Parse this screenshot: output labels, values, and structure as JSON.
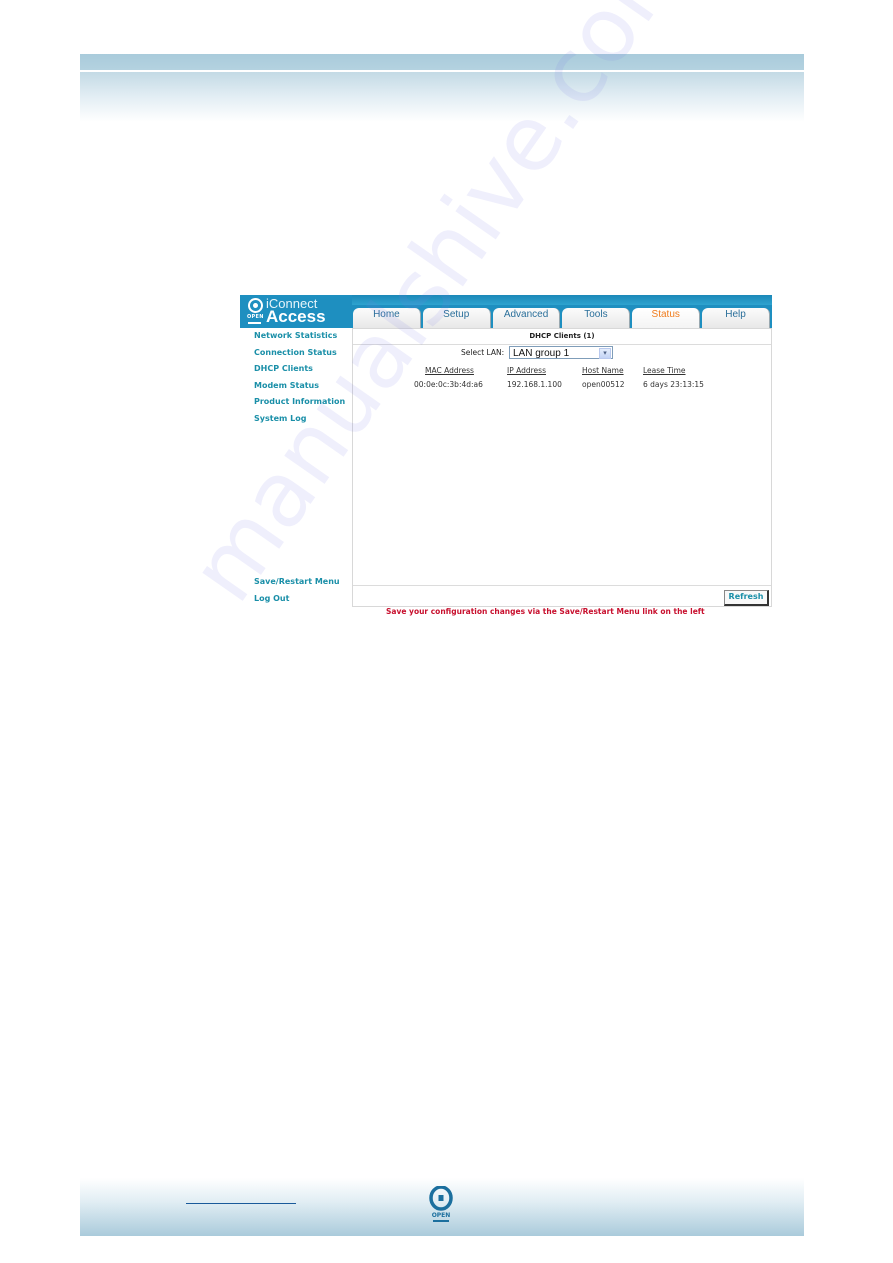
{
  "brand": {
    "line1": "iConnect",
    "line2": "Access",
    "logo_mini": "OPEN"
  },
  "tabs": [
    {
      "label": "Home",
      "active": false
    },
    {
      "label": "Setup",
      "active": false
    },
    {
      "label": "Advanced",
      "active": false
    },
    {
      "label": "Tools",
      "active": false
    },
    {
      "label": "Status",
      "active": true
    },
    {
      "label": "Help",
      "active": false
    }
  ],
  "sidebar": {
    "items": [
      {
        "label": "Network Statistics"
      },
      {
        "label": "Connection Status"
      },
      {
        "label": "DHCP Clients"
      },
      {
        "label": "Modem Status"
      },
      {
        "label": "Product Information"
      },
      {
        "label": "System Log"
      }
    ],
    "bottom_items": [
      {
        "label": "Save/Restart Menu"
      },
      {
        "label": "Log Out"
      }
    ]
  },
  "panel": {
    "title": "DHCP Clients (1)",
    "select_label": "Select LAN:",
    "select_value": "LAN group 1",
    "columns": [
      "MAC Address",
      "IP Address",
      "Host Name",
      "Lease Time"
    ],
    "rows": [
      [
        "00:0e:0c:3b:4d:a6",
        "192.168.1.100",
        "open00512",
        "6 days 23:13:15"
      ]
    ],
    "refresh_label": "Refresh"
  },
  "save_note": "Save your configuration changes via the Save/Restart Menu link on the left",
  "footer": {
    "logo_text": "OPEN"
  },
  "watermark": "manualshive.com",
  "colors": {
    "accent": "#1e8fc0",
    "active_tab": "#f07c1c",
    "link": "#1a8fa8",
    "warning": "#c8102e"
  }
}
